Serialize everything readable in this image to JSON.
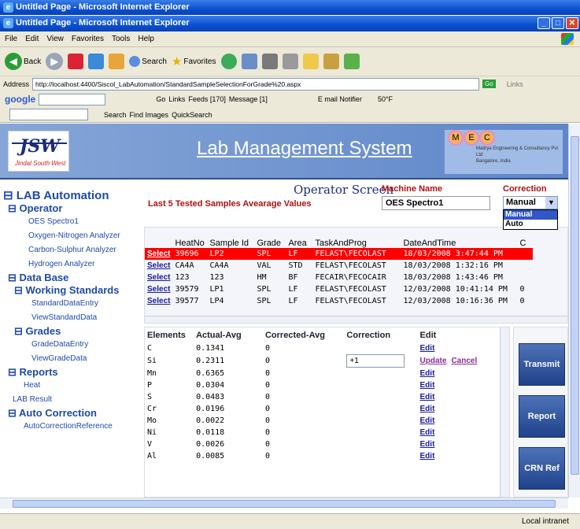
{
  "window": {
    "title": "Untitled Page - Microsoft Internet Explorer"
  },
  "menu": [
    "File",
    "Edit",
    "View",
    "Favorites",
    "Tools",
    "Help"
  ],
  "toolbar": {
    "back": "Back",
    "search": "Search",
    "favorites": "Favorites"
  },
  "address": {
    "label": "Address",
    "url": "http://localhost:4400/Siscol_LabAutomation/StandardSampleSelectionForGrade%20.aspx",
    "go": "Go",
    "links": "Links"
  },
  "google_bar": {
    "brand": "google",
    "go": "Go",
    "links": "Links",
    "feeds": "Feeds [170]",
    "message": "Message [1]",
    "email": "E mail Notifier",
    "weather": "50°F"
  },
  "search_bar": {
    "search": "Search",
    "find_images": "Find Images",
    "quicksearch": "QuickSearch"
  },
  "banner": {
    "logo": "JSW",
    "logo_sub": "Jindal South West",
    "title": "Lab Management System",
    "company": "Maitrye Engineering & Consultancy Pvt Ltd",
    "city": "Bangalore, India",
    "mec": [
      "M",
      "E",
      "C"
    ]
  },
  "nav": {
    "root": "LAB Automation",
    "operator": "Operator",
    "operator_items": [
      "OES Spectro1",
      "Oxygen-Nitrogen Analyzer",
      "Carbon-Sulphur Analyzer",
      "Hydrogen Analyzer"
    ],
    "database": "Data Base",
    "working_standards": "Working Standards",
    "ws_items": [
      "StandardDataEntry",
      "ViewStandardData"
    ],
    "grades": "Grades",
    "grade_items": [
      "GradeDataEntry",
      "ViewGradeData"
    ],
    "reports": "Reports",
    "report_items": [
      "Heat"
    ],
    "lab_result": "LAB Result",
    "auto_correction": "Auto Correction",
    "ac_items": [
      "AutoCorrectionReference"
    ]
  },
  "screen": {
    "title": "Operator Screen",
    "subtitle": "Last 5 Tested Samples Avearage Values",
    "machine_label": "Machine Name",
    "machine_value": "OES Spectro1",
    "correction_label": "Correction",
    "correction_value": "Manual",
    "correction_options": [
      "Manual",
      "Auto"
    ]
  },
  "samples": {
    "headers": [
      "",
      "HeatNo",
      "Sample Id",
      "Grade",
      "Area",
      "TaskAndProg",
      "DateAndTime",
      "C"
    ],
    "rows": [
      [
        "Select",
        "39696",
        "LP2",
        "SPL",
        "LF",
        "FELAST\\FECOLAST",
        "18/03/2008 3:47:44 PM",
        ""
      ],
      [
        "Select",
        "CA4A",
        "CA4A",
        "VAL",
        "STD",
        "FELAST\\FECOLAST",
        "18/03/2008 1:32:16 PM",
        ""
      ],
      [
        "Select",
        "123",
        "123",
        "HM",
        "BF",
        "FECAIR\\FECOCAIR",
        "18/03/2008 1:43:46 PM",
        ""
      ],
      [
        "Select",
        "39579",
        "LP1",
        "SPL",
        "LF",
        "FELAST\\FECOLAST",
        "12/03/2008 10:41:14 PM",
        "0"
      ],
      [
        "Select",
        "39577",
        "LP4",
        "SPL",
        "LF",
        "FELAST\\FECOLAST",
        "12/03/2008 10:16:36 PM",
        "0"
      ]
    ]
  },
  "elements": {
    "headers": [
      "Elements",
      "Actual-Avg",
      "Corrected-Avg",
      "Correction",
      "Edit"
    ],
    "rows": [
      [
        "C",
        "0.1341",
        "0",
        "",
        "Edit"
      ],
      [
        "Si",
        "0.2311",
        "0",
        "+1",
        "Update Cancel"
      ],
      [
        "Mn",
        "0.6365",
        "0",
        "",
        "Edit"
      ],
      [
        "P",
        "0.0304",
        "0",
        "",
        "Edit"
      ],
      [
        "S",
        "0.0483",
        "0",
        "",
        "Edit"
      ],
      [
        "Cr",
        "0.0196",
        "0",
        "",
        "Edit"
      ],
      [
        "Mo",
        "0.0022",
        "0",
        "",
        "Edit"
      ],
      [
        "Ni",
        "0.0118",
        "0",
        "",
        "Edit"
      ],
      [
        "V",
        "0.0026",
        "0",
        "",
        "Edit"
      ],
      [
        "Al",
        "0.0085",
        "0",
        "",
        "Edit"
      ]
    ]
  },
  "buttons": {
    "transmit": "Transmit",
    "report": "Report",
    "crn": "CRN Ref"
  },
  "status": {
    "zone": "Local intranet"
  }
}
